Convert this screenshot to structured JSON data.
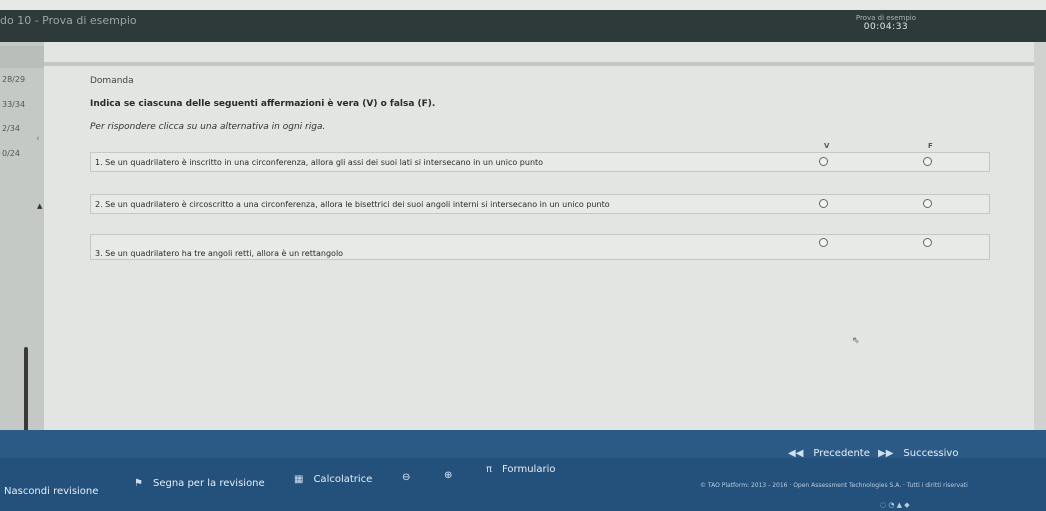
{
  "header": {
    "title": "do 10 - Prova di esempio",
    "subtitle": "Prova di esempio",
    "timer": "00:04:33"
  },
  "leftnav": {
    "counts": [
      "28/29",
      "33/34",
      "2/34",
      "0/24"
    ]
  },
  "question": {
    "heading": "Domanda",
    "prompt": "Indica se ciascuna delle seguenti affermazioni è vera (V) o falsa (F).",
    "instruction": "Per rispondere clicca su una alternativa in ogni riga.",
    "columns": {
      "true_label": "V",
      "false_label": "F"
    },
    "rows": [
      {
        "text": "1. Se un quadrilatero è inscritto in una circonferenza, allora gli assi dei suoi lati si intersecano in un unico punto"
      },
      {
        "text": "2. Se un quadrilatero è circoscritto a una circonferenza, allora le bisettrici dei suoi angoli interni si intersecano in un unico punto"
      },
      {
        "text": "3. Se un quadrilatero ha tre angoli retti, allora è un rettangolo"
      }
    ]
  },
  "toolbar": {
    "prev_label": "Precedente",
    "next_label": "Successivo",
    "hide_review_label": "Nascondi revisione",
    "mark_review_label": "Segna per la revisione",
    "calculator_label": "Calcolatrice",
    "formulary_label": "Formulario",
    "footer_note": "© TAO Platform: 2013 - 2016 · Open Assessment Technologies S.A. · Tutti i diritti riservati"
  },
  "colors": {
    "header_bg": "#2e3a3a",
    "toolbar_bg": "#2c5a86",
    "content_bg": "#e3e5e2"
  }
}
